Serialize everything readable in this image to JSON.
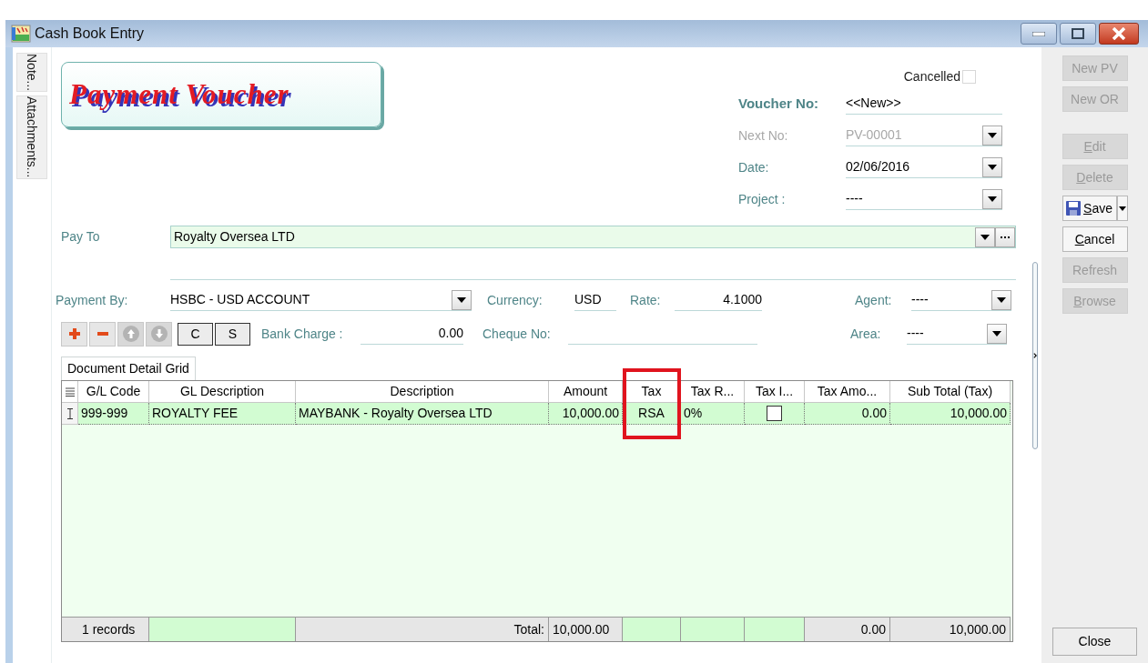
{
  "window": {
    "title": "Cash Book Entry"
  },
  "side_tabs": [
    {
      "label": "Note..."
    },
    {
      "label": "Attachments..."
    }
  ],
  "banner": {
    "title": "Payment Voucher"
  },
  "cancelled": {
    "label": "Cancelled",
    "checked": false
  },
  "header_fields": [
    {
      "label": "Voucher No:",
      "value": "<<New>>",
      "kind": "plain",
      "disabled": false
    },
    {
      "label": "Next No:",
      "value": "PV-00001",
      "kind": "dropdown",
      "disabled": true
    },
    {
      "label": "Date:",
      "value": "02/06/2016",
      "kind": "dropdown",
      "disabled": false
    },
    {
      "label": "Project :",
      "value": "----",
      "kind": "dropdown",
      "disabled": false
    }
  ],
  "pay_to": {
    "label": "Pay To",
    "value": "Royalty Oversea LTD"
  },
  "payment_by": {
    "label": "Payment By:",
    "value": "HSBC - USD ACCOUNT"
  },
  "currency": {
    "label": "Currency:",
    "value": "USD"
  },
  "rate": {
    "label": "Rate:",
    "value": "4.1000"
  },
  "agent": {
    "label": "Agent:",
    "value": "----"
  },
  "bank_charge": {
    "label": "Bank Charge :",
    "value": "0.00"
  },
  "cheque_no": {
    "label": "Cheque No:"
  },
  "area": {
    "label": "Area:",
    "value": "----"
  },
  "toolbar": {
    "icon_buttons": [
      {
        "kind": "add",
        "disabled": false
      },
      {
        "kind": "remove",
        "disabled": false
      },
      {
        "kind": "up",
        "disabled": true
      },
      {
        "kind": "down",
        "disabled": true
      }
    ],
    "text_buttons": [
      {
        "label": "C"
      },
      {
        "label": "S"
      }
    ]
  },
  "grid_tab": {
    "label": "Document Detail Grid",
    "selected": true
  },
  "columns": [
    {
      "title": "G/L Code",
      "kind": "text",
      "highlighted": false,
      "footer": {
        "text": "1 records",
        "kind": "count"
      }
    },
    {
      "title": "GL Description",
      "kind": "text",
      "highlighted": false
    },
    {
      "title": "Description",
      "kind": "text",
      "highlighted": false,
      "footer": {
        "text": "Total:",
        "kind": "caption"
      }
    },
    {
      "title": "Amount",
      "kind": "number",
      "highlighted": false,
      "footer": {
        "text": "10,000.00",
        "kind": "total"
      }
    },
    {
      "title": "Tax",
      "kind": "code",
      "highlighted": true
    },
    {
      "title": "Tax R...",
      "kind": "text",
      "highlighted": false
    },
    {
      "title": "Tax I...",
      "kind": "checkbox",
      "highlighted": false
    },
    {
      "title": "Tax Amo...",
      "kind": "number",
      "highlighted": false,
      "footer": {
        "text": "0.00",
        "kind": "sum"
      }
    },
    {
      "title": "Sub Total (Tax)",
      "kind": "number",
      "highlighted": false,
      "footer": {
        "text": "10,000.00",
        "kind": "sum"
      }
    }
  ],
  "rows": [
    {
      "cells": [
        {
          "text": "999-999"
        },
        {
          "text": "ROYALTY FEE"
        },
        {
          "text": "MAYBANK - Royalty Oversea LTD"
        },
        {
          "text": "10,000.00"
        },
        {
          "text": "RSA"
        },
        {
          "text": "0%"
        },
        {
          "checked": false
        },
        {
          "text": "0.00"
        },
        {
          "text": "10,000.00"
        }
      ]
    }
  ],
  "side_buttons": [
    {
      "label": "New PV",
      "kind": "plain",
      "disabled": true,
      "mnemonic": false
    },
    {
      "label": "New OR",
      "kind": "plain",
      "disabled": true,
      "mnemonic": false
    },
    {
      "label": "Edit",
      "kind": "plain",
      "disabled": true,
      "mnemonic": true
    },
    {
      "label": "Delete",
      "kind": "plain",
      "disabled": true,
      "mnemonic": true
    },
    {
      "label": "Save",
      "kind": "split",
      "disabled": false,
      "mnemonic": true
    },
    {
      "label": "Cancel",
      "kind": "plain",
      "disabled": false,
      "mnemonic": true
    },
    {
      "label": "Refresh",
      "kind": "plain",
      "disabled": true,
      "mnemonic": false
    },
    {
      "label": "Browse",
      "kind": "plain",
      "disabled": true,
      "mnemonic": true
    }
  ],
  "close_button": {
    "label": "Close"
  }
}
